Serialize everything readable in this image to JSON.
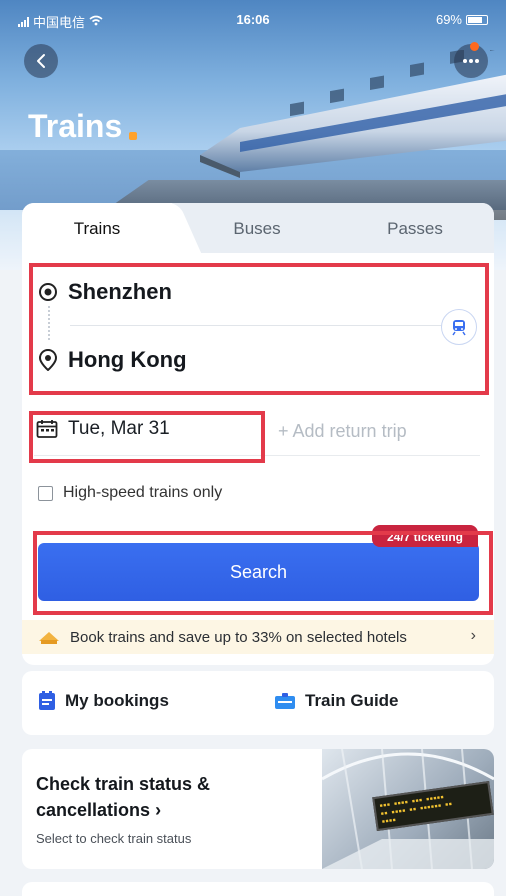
{
  "status_bar": {
    "carrier": "中国电信",
    "time": "16:06",
    "battery": "69%"
  },
  "header": {
    "title": "Trains"
  },
  "tabs": [
    {
      "label": "Trains",
      "active": true
    },
    {
      "label": "Buses",
      "active": false
    },
    {
      "label": "Passes",
      "active": false
    }
  ],
  "route": {
    "from": "Shenzhen",
    "to": "Hong Kong"
  },
  "date": {
    "depart": "Tue, Mar 31",
    "return_placeholder": "+ Add return trip"
  },
  "options": {
    "high_speed_label": "High-speed trains only",
    "high_speed_checked": false
  },
  "search": {
    "badge": "24/7 ticketing",
    "label": "Search"
  },
  "promo": {
    "text": "Book trains and save up to 33% on selected hotels",
    "arrow": "›"
  },
  "links": {
    "bookings": "My bookings",
    "guide": "Train Guide"
  },
  "status_card": {
    "title": "Check train status & cancellations",
    "arrow": "›",
    "subtitle": "Select to check train status"
  },
  "colors": {
    "accent": "#3366ee",
    "highlight": "#e33a4a",
    "badge": "#c9243f",
    "title_dot": "#ffa22c"
  },
  "icons": [
    "back-arrow-icon",
    "more-icon",
    "origin-target-icon",
    "location-pin-icon",
    "swap-train-icon",
    "calendar-icon",
    "hotel-icon",
    "bookings-icon",
    "train-guide-icon"
  ]
}
